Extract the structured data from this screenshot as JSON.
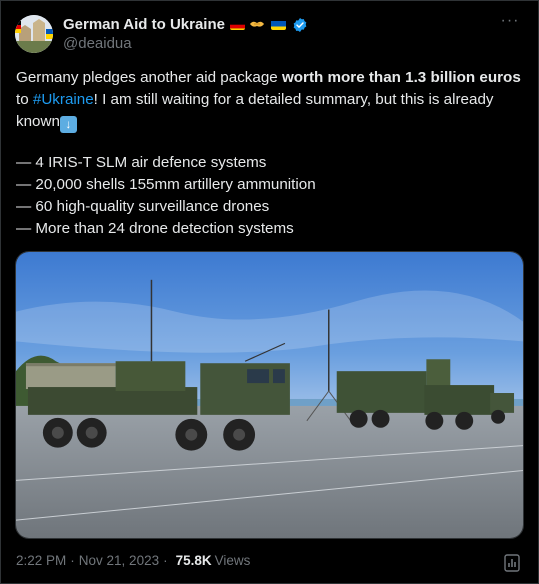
{
  "tweet": {
    "display_name": "German Aid to Ukraine",
    "handle": "@deaidua",
    "more_label": "···",
    "text": {
      "part1": "Germany pledges another aid package ",
      "bold": "worth more than 1.3 billion euros",
      "part2": " to ",
      "hashtag": "#Ukraine",
      "part3": "! I am still waiting for a detailed summary, but this is already known"
    },
    "list": [
      "— 4 IRIS-T SLM air defence systems",
      "— 20,000 shells 155mm artillery ammunition",
      "— 60 high-quality surveillance drones",
      "— More than 24 drone detection systems"
    ],
    "time": "2:22 PM",
    "date": "Nov 21, 2023",
    "separator": "·",
    "views_count": "75.8K",
    "views_label": "Views"
  },
  "icons": {
    "verified": "verified-badge-icon",
    "down_arrow": "down-arrow-emoji-icon",
    "analytics": "analytics-icon"
  },
  "colors": {
    "background": "#000000",
    "text": "#e7e9ea",
    "muted": "#71767b",
    "link": "#1d9bf0",
    "border": "#2f3336"
  }
}
